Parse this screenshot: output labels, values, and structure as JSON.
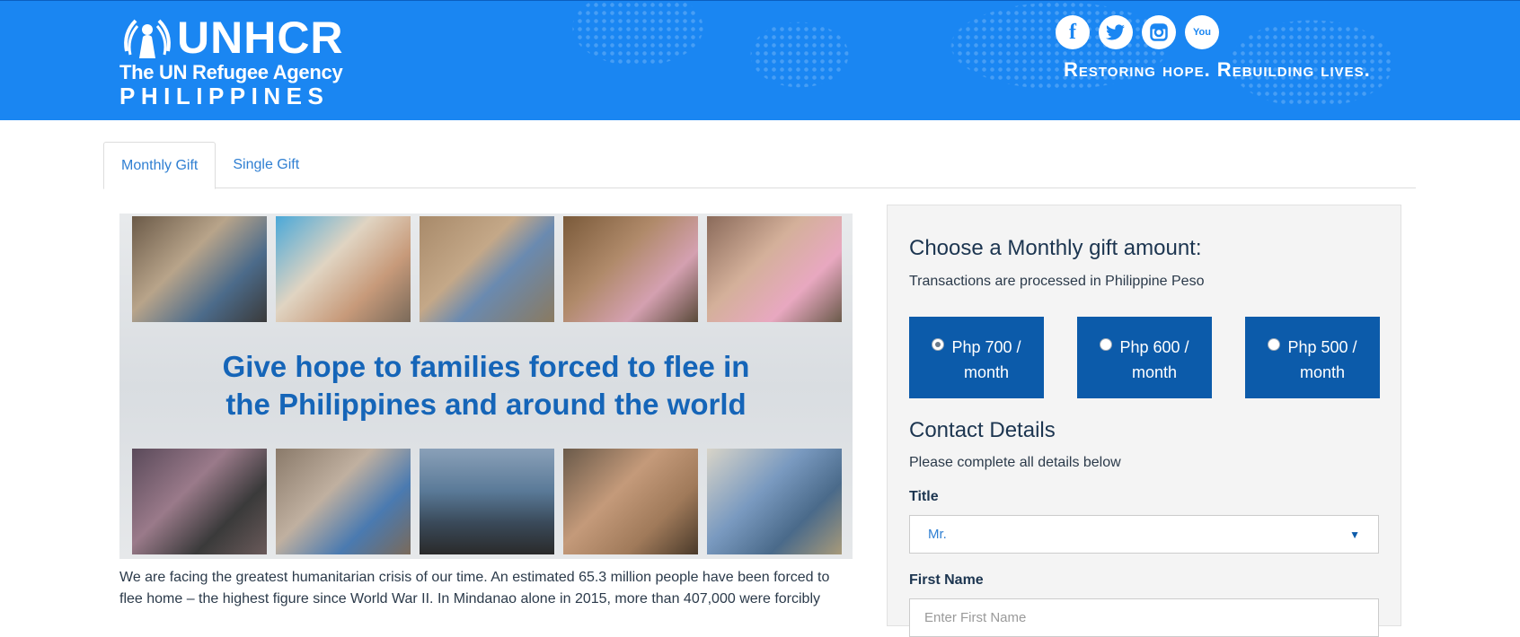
{
  "header": {
    "logo_main": "UNHCR",
    "logo_sub": "The UN Refugee Agency",
    "logo_country": "PHILIPPINES",
    "tagline": "Restoring hope. Rebuilding lives.",
    "social": [
      {
        "icon": "facebook-icon",
        "glyph": "f"
      },
      {
        "icon": "twitter-icon",
        "glyph": "t"
      },
      {
        "icon": "instagram-icon",
        "glyph": "◎"
      },
      {
        "icon": "youtube-icon",
        "glyph": "You"
      }
    ],
    "brand_color": "#1a86f2"
  },
  "tabs": [
    {
      "label": "Monthly Gift",
      "active": true
    },
    {
      "label": "Single Gift",
      "active": false
    }
  ],
  "left": {
    "headline_line1": "Give hope to families forced to flee in",
    "headline_line2": "the Philippines and around the world",
    "intro_line1": "We are facing the greatest humanitarian crisis of our time. An estimated 65.3 million people have been forced to",
    "intro_line2": "flee home – the highest figure since World War II. In Mindanao alone in 2015, more than 407,000 were forcibly"
  },
  "form": {
    "title": "Choose a Monthly gift amount:",
    "subtitle": "Transactions are processed in Philippine Peso",
    "amounts": [
      {
        "line1": "Php 700 /",
        "line2": "month",
        "selected": true
      },
      {
        "line1": "Php 600 /",
        "line2": "month",
        "selected": false
      },
      {
        "line1": "Php 500 /",
        "line2": "month",
        "selected": false
      }
    ],
    "contact_title": "Contact Details",
    "contact_sub": "Please complete all details below",
    "title_label": "Title",
    "title_value": "Mr.",
    "first_name_label": "First Name",
    "first_name_placeholder": "Enter First Name",
    "accent_color": "#0c5baa"
  }
}
